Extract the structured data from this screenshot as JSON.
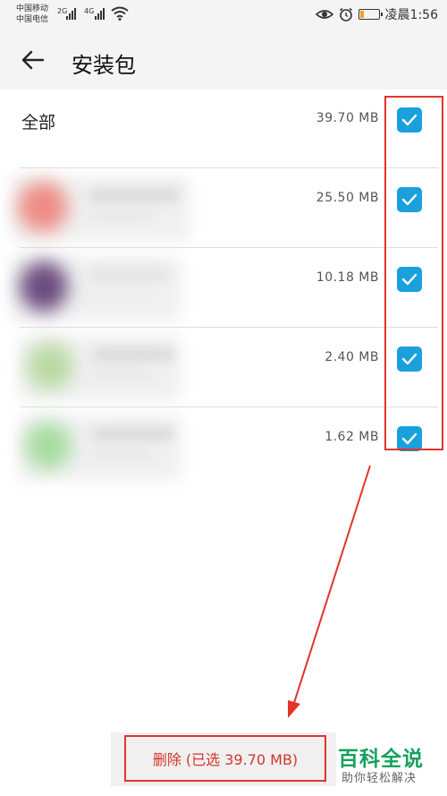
{
  "status_bar": {
    "carrier_1": "中国移动",
    "carrier_2": "中国电信",
    "sig1_label": "2G",
    "sig2_label": "4G",
    "time": "凌晨1:56"
  },
  "header": {
    "title": "安装包"
  },
  "list": {
    "all_label": "全部",
    "all_size": "39.70 MB",
    "items": [
      {
        "size": "25.50 MB",
        "icon_color": "#ee8c86"
      },
      {
        "size": "10.18 MB",
        "icon_color": "#6b4c7e"
      },
      {
        "size": "2.40 MB",
        "icon_color": "#b9d9a3"
      },
      {
        "size": "1.62 MB",
        "icon_color": "#a6dca0"
      }
    ]
  },
  "bottom": {
    "delete_label": "删除 (已选 39.70 MB)"
  },
  "watermark": {
    "title": "百科全说",
    "subtitle": "助你轻松解决"
  },
  "colors": {
    "accent": "#1aa0dd",
    "annotation": "#e4332b",
    "brand": "#17a05d"
  }
}
